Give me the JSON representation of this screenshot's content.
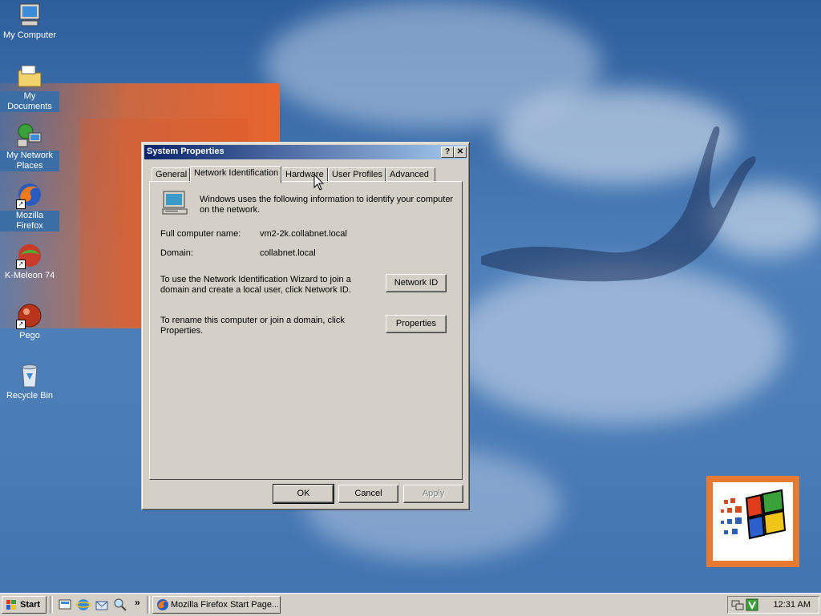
{
  "desktop": {
    "icons": [
      {
        "label": "My Computer"
      },
      {
        "label": "My Documents"
      },
      {
        "label": "My Network Places"
      },
      {
        "label": "Mozilla Firefox"
      },
      {
        "label": "K-Meleon 74"
      },
      {
        "label": "Pego"
      },
      {
        "label": "Recycle Bin"
      }
    ]
  },
  "dialog": {
    "title": "System Properties",
    "help_btn": "?",
    "close_btn": "✕",
    "tabs": [
      {
        "label": "General"
      },
      {
        "label": "Network Identification",
        "active": true
      },
      {
        "label": "Hardware"
      },
      {
        "label": "User Profiles"
      },
      {
        "label": "Advanced"
      }
    ],
    "intro_line1": "Windows uses the following information to identify your computer",
    "intro_line2": "on the network.",
    "full_name_label": "Full computer name:",
    "full_name_value": "vm2-2k.collabnet.local",
    "domain_label": "Domain:",
    "domain_value": "collabnet.local",
    "wizard_line1": "To use the Network Identification Wizard to join a",
    "wizard_line2": "domain and create a local user, click Network ID.",
    "network_id_btn": "Network ID",
    "rename_line1": "To rename this computer or join a domain, click",
    "rename_line2": "Properties.",
    "properties_btn": "Properties",
    "ok_btn": "OK",
    "cancel_btn": "Cancel",
    "apply_btn": "Apply"
  },
  "taskbar": {
    "start_label": "Start",
    "overflow": "»",
    "task_label": "Mozilla Firefox Start Page...",
    "clock": "12:31 AM"
  },
  "colors": {
    "titlebar_start": "#0a246a",
    "titlebar_end": "#a6caf0",
    "face": "#d4d0c8",
    "desktop": "#3d6fae"
  }
}
